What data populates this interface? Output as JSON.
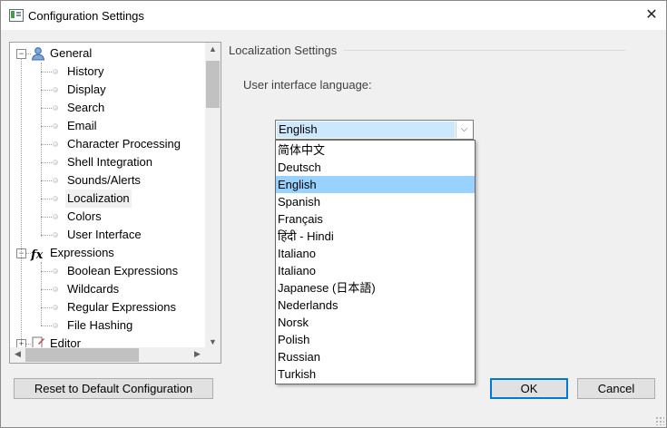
{
  "window": {
    "title": "Configuration Settings",
    "close_symbol": "✕"
  },
  "tree": {
    "items": [
      {
        "label": "General",
        "level": 0,
        "expander": "−",
        "icon": "user-icon"
      },
      {
        "label": "History",
        "level": 1
      },
      {
        "label": "Display",
        "level": 1
      },
      {
        "label": "Search",
        "level": 1
      },
      {
        "label": "Email",
        "level": 1
      },
      {
        "label": "Character Processing",
        "level": 1
      },
      {
        "label": "Shell Integration",
        "level": 1
      },
      {
        "label": "Sounds/Alerts",
        "level": 1
      },
      {
        "label": "Localization",
        "level": 1,
        "selected": true
      },
      {
        "label": "Colors",
        "level": 1
      },
      {
        "label": "User Interface",
        "level": 1
      },
      {
        "label": "Expressions",
        "level": 0,
        "expander": "−",
        "icon": "function-icon",
        "icon_text": "fx"
      },
      {
        "label": "Boolean Expressions",
        "level": 1
      },
      {
        "label": "Wildcards",
        "level": 1
      },
      {
        "label": "Regular Expressions",
        "level": 1
      },
      {
        "label": "File Hashing",
        "level": 1
      },
      {
        "label": "Editor",
        "level": 0,
        "expander": "+",
        "icon": "editor-icon"
      }
    ]
  },
  "section": {
    "title": "Localization Settings",
    "language_label": "User interface language:",
    "selected_language": "English",
    "languages": [
      "简体中文",
      "Deutsch",
      "English",
      "Spanish",
      "Français",
      "हिंदी - Hindi",
      "Italiano",
      "Italiano",
      "Japanese (日本語)",
      "Nederlands",
      "Norsk",
      "Polish",
      "Russian",
      "Turkish"
    ],
    "highlighted_index": 2
  },
  "buttons": {
    "reset": "Reset to Default Configuration",
    "ok": "OK",
    "cancel": "Cancel"
  },
  "colors": {
    "selection": "#99d1ff",
    "combo_selection": "#cce8ff",
    "default_button_border": "#0078d7"
  }
}
